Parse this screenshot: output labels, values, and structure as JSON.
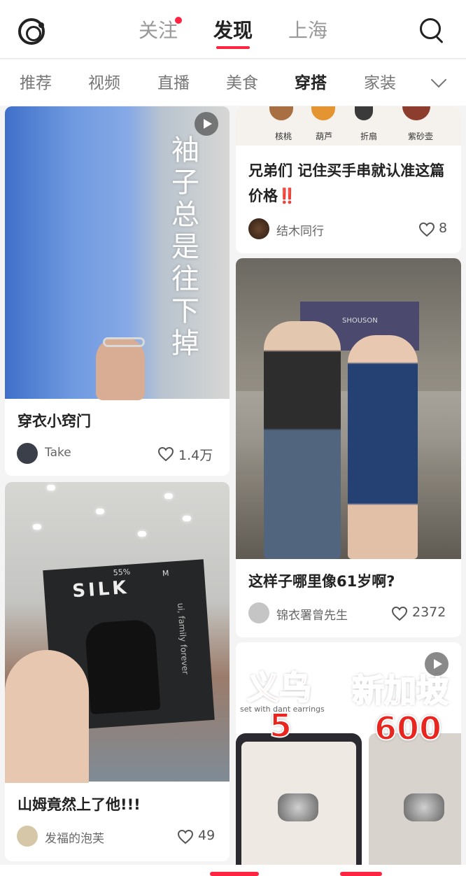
{
  "header": {
    "tabs": [
      {
        "label": "关注",
        "has_dot": true
      },
      {
        "label": "发现",
        "active": true
      },
      {
        "label": "上海"
      }
    ]
  },
  "categories": {
    "items": [
      "推荐",
      "视频",
      "直播",
      "美食",
      "穿搭",
      "家装"
    ],
    "active": "穿搭"
  },
  "feed": {
    "card_a": {
      "overlay_text": "袖子总是往下掉",
      "title": "穿衣小窍门",
      "author": "Take",
      "likes": "1.4万",
      "is_video": true
    },
    "card_b": {
      "image_items": [
        "核桃",
        "葫芦",
        "折扇",
        "紫砂壶"
      ],
      "title": "兄弟们 记住买手串就认准这篇价格‼️",
      "author": "结木同行",
      "likes": "8"
    },
    "card_c": {
      "image_text": "SHOUSON",
      "title": "这样子哪里像61岁啊?",
      "author": "锦衣署曾先生",
      "likes": "2372"
    },
    "card_d": {
      "package_brand": "SILK",
      "package_size": "M",
      "package_sub": "55%",
      "package_side": "ui, family forever",
      "title": "山姆竟然上了他!!!",
      "author": "发福的泡芙",
      "likes": "49"
    },
    "card_e": {
      "left_city": "义乌",
      "left_price": "5",
      "right_city": "新加坡",
      "right_price": "600",
      "strip_text": "set   with  dant   earrings",
      "is_video": true
    }
  },
  "colors": {
    "accent": "#ff2442",
    "text_primary": "#222222",
    "text_secondary": "#999999"
  }
}
